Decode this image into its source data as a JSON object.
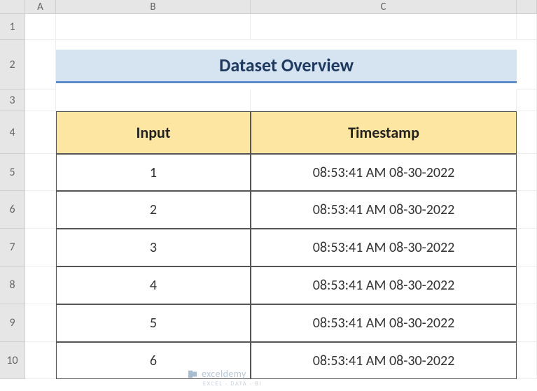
{
  "columns": [
    "A",
    "B",
    "C",
    ""
  ],
  "rows": [
    "1",
    "2",
    "3",
    "4",
    "5",
    "6",
    "7",
    "8",
    "9",
    "10"
  ],
  "title": "Dataset Overview",
  "headers": {
    "input": "Input",
    "timestamp": "Timestamp"
  },
  "data": [
    {
      "input": "1",
      "timestamp": "08:53:41 AM 08-30-2022"
    },
    {
      "input": "2",
      "timestamp": "08:53:41 AM 08-30-2022"
    },
    {
      "input": "3",
      "timestamp": "08:53:41 AM 08-30-2022"
    },
    {
      "input": "4",
      "timestamp": "08:53:41 AM 08-30-2022"
    },
    {
      "input": "5",
      "timestamp": "08:53:41 AM 08-30-2022"
    },
    {
      "input": "6",
      "timestamp": "08:53:41 AM 08-30-2022"
    }
  ],
  "watermark": {
    "name": "exceldemy",
    "sub": "EXCEL · DATA · BI"
  }
}
